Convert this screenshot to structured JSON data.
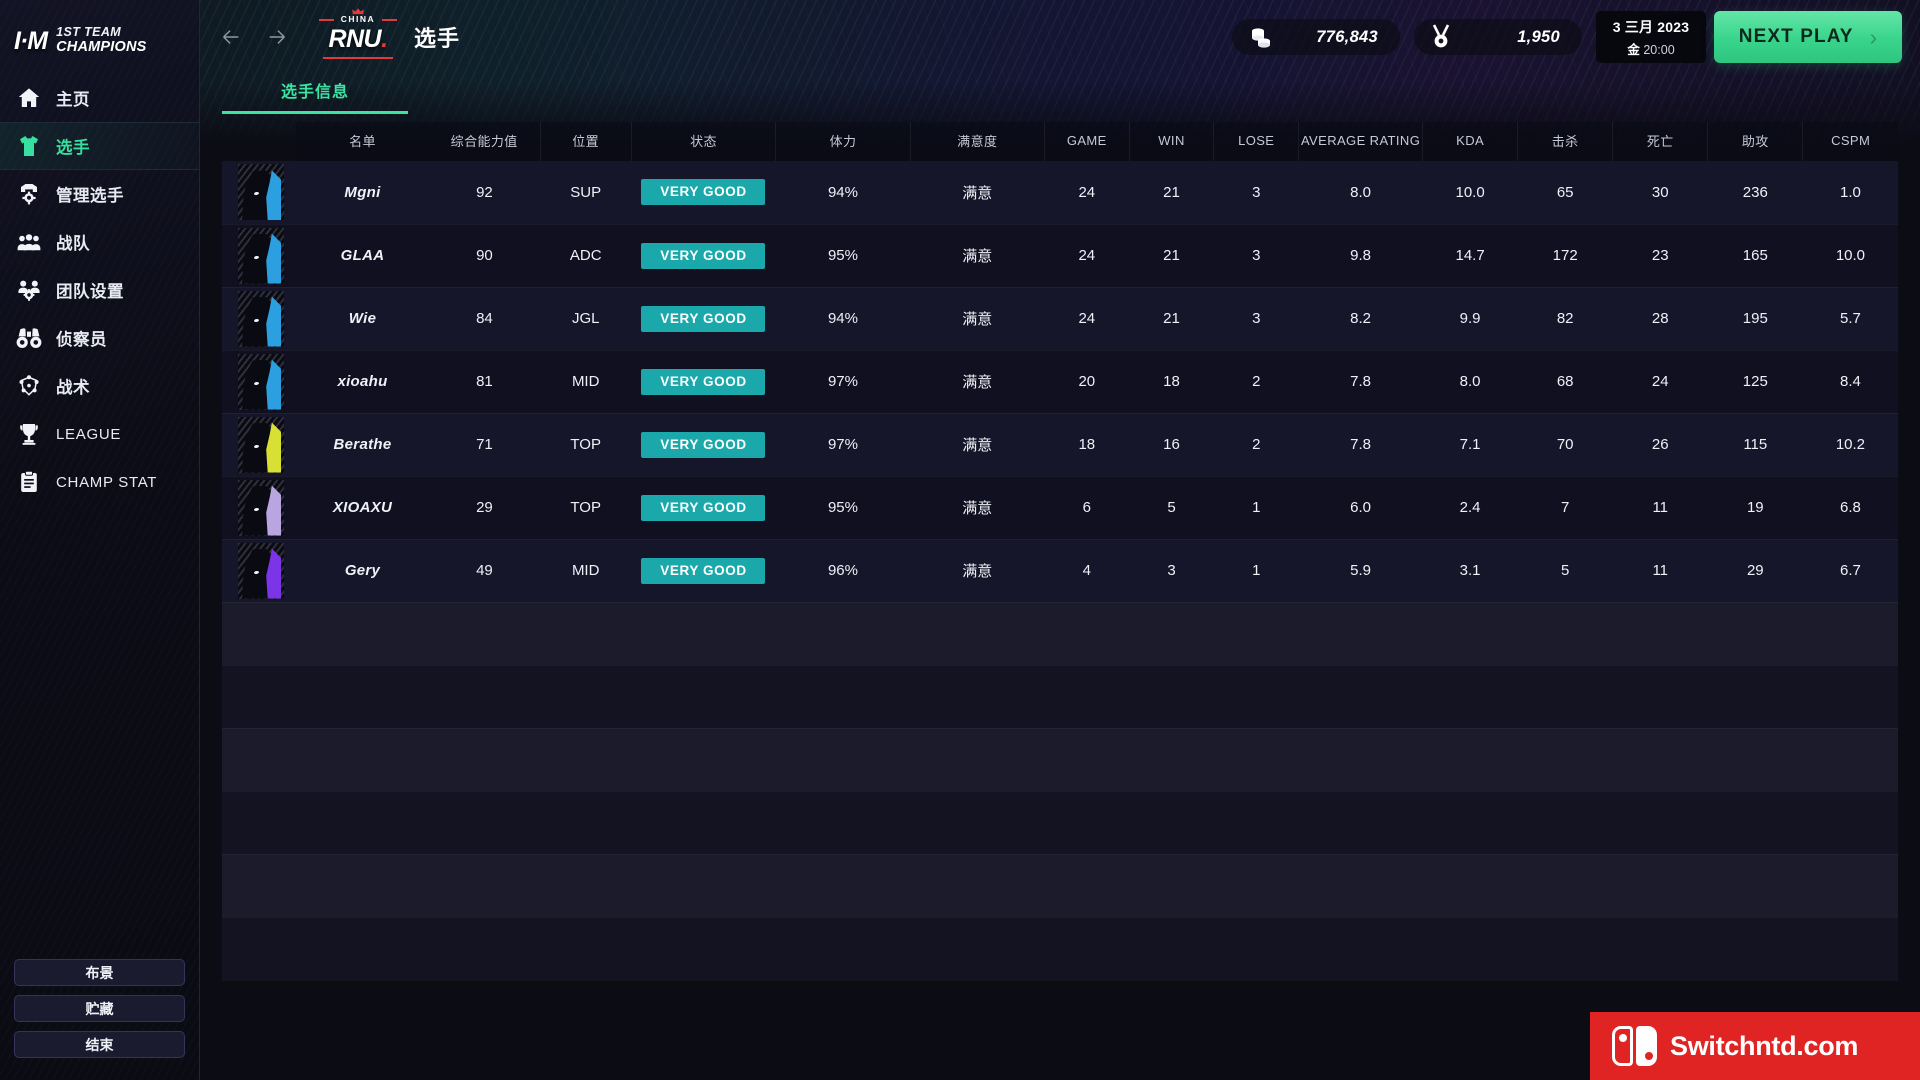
{
  "brand": {
    "mark": "I·M",
    "line1": "1ST TEAM",
    "line2": "CHAMPIONS"
  },
  "sidebar": {
    "items": [
      {
        "label": "主页",
        "icon": "home-icon",
        "active": false
      },
      {
        "label": "选手",
        "icon": "jersey-icon",
        "active": true
      },
      {
        "label": "管理选手",
        "icon": "player-settings-icon",
        "active": false
      },
      {
        "label": "战队",
        "icon": "team-icon",
        "active": false
      },
      {
        "label": "团队设置",
        "icon": "team-settings-icon",
        "active": false
      },
      {
        "label": "侦察员",
        "icon": "binoculars-icon",
        "active": false
      },
      {
        "label": "战术",
        "icon": "tactics-icon",
        "active": false
      },
      {
        "label": "LEAGUE",
        "icon": "trophy-icon",
        "active": false
      },
      {
        "label": "CHAMP STAT",
        "icon": "clipboard-icon",
        "active": false
      }
    ],
    "buttons": [
      {
        "label": "布景"
      },
      {
        "label": "贮藏"
      },
      {
        "label": "结束"
      }
    ]
  },
  "header": {
    "back_arrow": "←",
    "forward_arrow": "→",
    "team_logo": {
      "region": "CHINA",
      "name": "RNU",
      "dot": "."
    },
    "page_title": "选手",
    "currency": {
      "money_icon": "coins-icon",
      "money_value": "776,843",
      "medal_icon": "medal-icon",
      "medal_value": "1,950"
    },
    "date": {
      "primary": "3 三月 2023",
      "weekday": "金",
      "time": "20:00"
    },
    "next_play": {
      "label": "NEXT PLAY",
      "chevron": "›"
    }
  },
  "tabs": [
    {
      "label": "选手信息",
      "active": true
    }
  ],
  "table": {
    "columns": [
      {
        "key": "avatar",
        "label": ""
      },
      {
        "key": "name",
        "label": "名单"
      },
      {
        "key": "overall",
        "label": "综合能力值"
      },
      {
        "key": "position",
        "label": "位置"
      },
      {
        "key": "status",
        "label": "状态"
      },
      {
        "key": "stamina",
        "label": "体力"
      },
      {
        "key": "satisfaction",
        "label": "满意度"
      },
      {
        "key": "game",
        "label": "GAME"
      },
      {
        "key": "win",
        "label": "WIN"
      },
      {
        "key": "lose",
        "label": "LOSE"
      },
      {
        "key": "avg_rating",
        "label": "AVERAGE RATING"
      },
      {
        "key": "kda",
        "label": "KDA"
      },
      {
        "key": "kills",
        "label": "击杀"
      },
      {
        "key": "deaths",
        "label": "死亡"
      },
      {
        "key": "assists",
        "label": "助攻"
      },
      {
        "key": "cspm",
        "label": "CSPM"
      }
    ],
    "rows": [
      {
        "avatar_color": "#2b9fe0",
        "name": "Mgni",
        "overall": "92",
        "position": "SUP",
        "status": "VERY GOOD",
        "stamina": "94%",
        "satisfaction": "满意",
        "game": "24",
        "win": "21",
        "lose": "3",
        "avg_rating": "8.0",
        "kda": "10.0",
        "kills": "65",
        "deaths": "30",
        "assists": "236",
        "cspm": "1.0"
      },
      {
        "avatar_color": "#2b9fe0",
        "name": "GLAA",
        "overall": "90",
        "position": "ADC",
        "status": "VERY GOOD",
        "stamina": "95%",
        "satisfaction": "满意",
        "game": "24",
        "win": "21",
        "lose": "3",
        "avg_rating": "9.8",
        "kda": "14.7",
        "kills": "172",
        "deaths": "23",
        "assists": "165",
        "cspm": "10.0"
      },
      {
        "avatar_color": "#2b9fe0",
        "name": "Wie",
        "overall": "84",
        "position": "JGL",
        "status": "VERY GOOD",
        "stamina": "94%",
        "satisfaction": "满意",
        "game": "24",
        "win": "21",
        "lose": "3",
        "avg_rating": "8.2",
        "kda": "9.9",
        "kills": "82",
        "deaths": "28",
        "assists": "195",
        "cspm": "5.7"
      },
      {
        "avatar_color": "#2b9fe0",
        "name": "xioahu",
        "overall": "81",
        "position": "MID",
        "status": "VERY GOOD",
        "stamina": "97%",
        "satisfaction": "满意",
        "game": "20",
        "win": "18",
        "lose": "2",
        "avg_rating": "7.8",
        "kda": "8.0",
        "kills": "68",
        "deaths": "24",
        "assists": "125",
        "cspm": "8.4"
      },
      {
        "avatar_color": "#d8e033",
        "name": "Berathe",
        "overall": "71",
        "position": "TOP",
        "status": "VERY GOOD",
        "stamina": "97%",
        "satisfaction": "满意",
        "game": "18",
        "win": "16",
        "lose": "2",
        "avg_rating": "7.8",
        "kda": "7.1",
        "kills": "70",
        "deaths": "26",
        "assists": "115",
        "cspm": "10.2"
      },
      {
        "avatar_color": "#b9a6e0",
        "name": "XIOAXU",
        "overall": "29",
        "position": "TOP",
        "status": "VERY GOOD",
        "stamina": "95%",
        "satisfaction": "满意",
        "game": "6",
        "win": "5",
        "lose": "1",
        "avg_rating": "6.0",
        "kda": "2.4",
        "kills": "7",
        "deaths": "11",
        "assists": "19",
        "cspm": "6.8"
      },
      {
        "avatar_color": "#7b34e6",
        "name": "Gery",
        "overall": "49",
        "position": "MID",
        "status": "VERY GOOD",
        "stamina": "96%",
        "satisfaction": "满意",
        "game": "4",
        "win": "3",
        "lose": "1",
        "avg_rating": "5.9",
        "kda": "3.1",
        "kills": "5",
        "deaths": "11",
        "assists": "29",
        "cspm": "6.7"
      }
    ],
    "empty_row_count": 6
  },
  "watermark": {
    "text": "Switchntd.com",
    "icon": "switch-logo-icon"
  },
  "colors": {
    "accent_green": "#3ce3a3",
    "badge_teal": "#1aa8ab",
    "watermark_red": "#e02424",
    "logo_red": "#e23a3a"
  }
}
